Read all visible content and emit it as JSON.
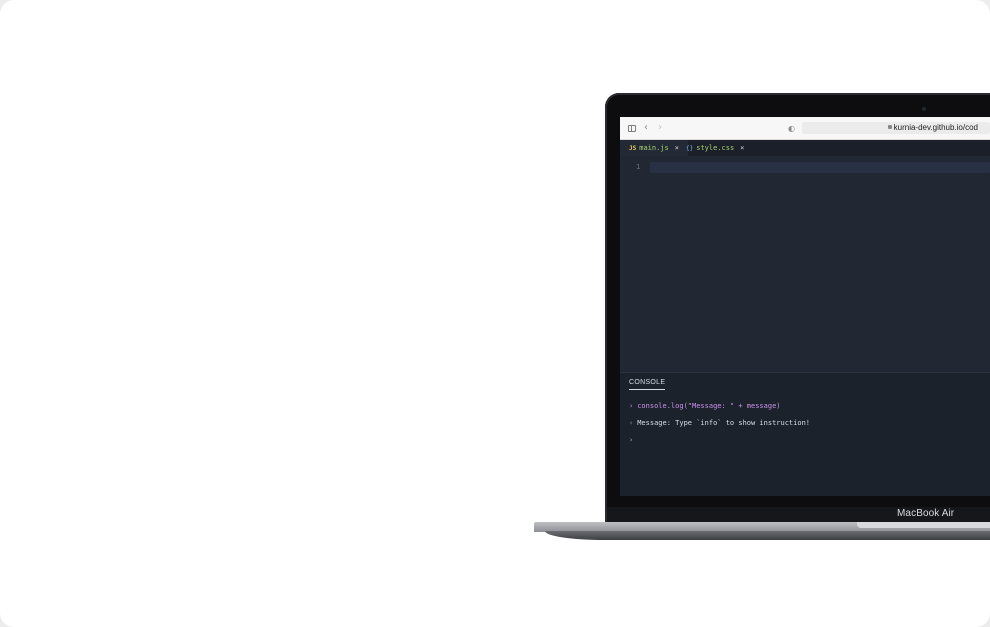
{
  "browser": {
    "url": "kurnia-dev.github.io/cod",
    "icons": [
      "sidebar-icon",
      "back-icon",
      "forward-icon",
      "shield-icon",
      "lock-icon"
    ]
  },
  "editor": {
    "tabs": [
      {
        "badge": "JS",
        "label": "main.js",
        "close": "×",
        "active": true
      },
      {
        "badge": "{}",
        "label": "style.css",
        "close": "×",
        "active": false
      }
    ],
    "line_numbers": [
      "1"
    ]
  },
  "console": {
    "title": "CONSOLE",
    "lines": [
      {
        "kind": "input",
        "marker": "›",
        "text": "console.log(\"Message: \" + message)"
      },
      {
        "kind": "output",
        "marker": "‹",
        "text": "Message: Type `info` to show instruction!"
      },
      {
        "kind": "prompt",
        "marker": "›",
        "text": ""
      }
    ]
  },
  "device": {
    "model": "MacBook Air"
  },
  "colors": {
    "editor_bg": "#212733",
    "console_bg": "#1c222c",
    "accent_purple": "#c792ea",
    "tab_text": "#a7d36b"
  }
}
